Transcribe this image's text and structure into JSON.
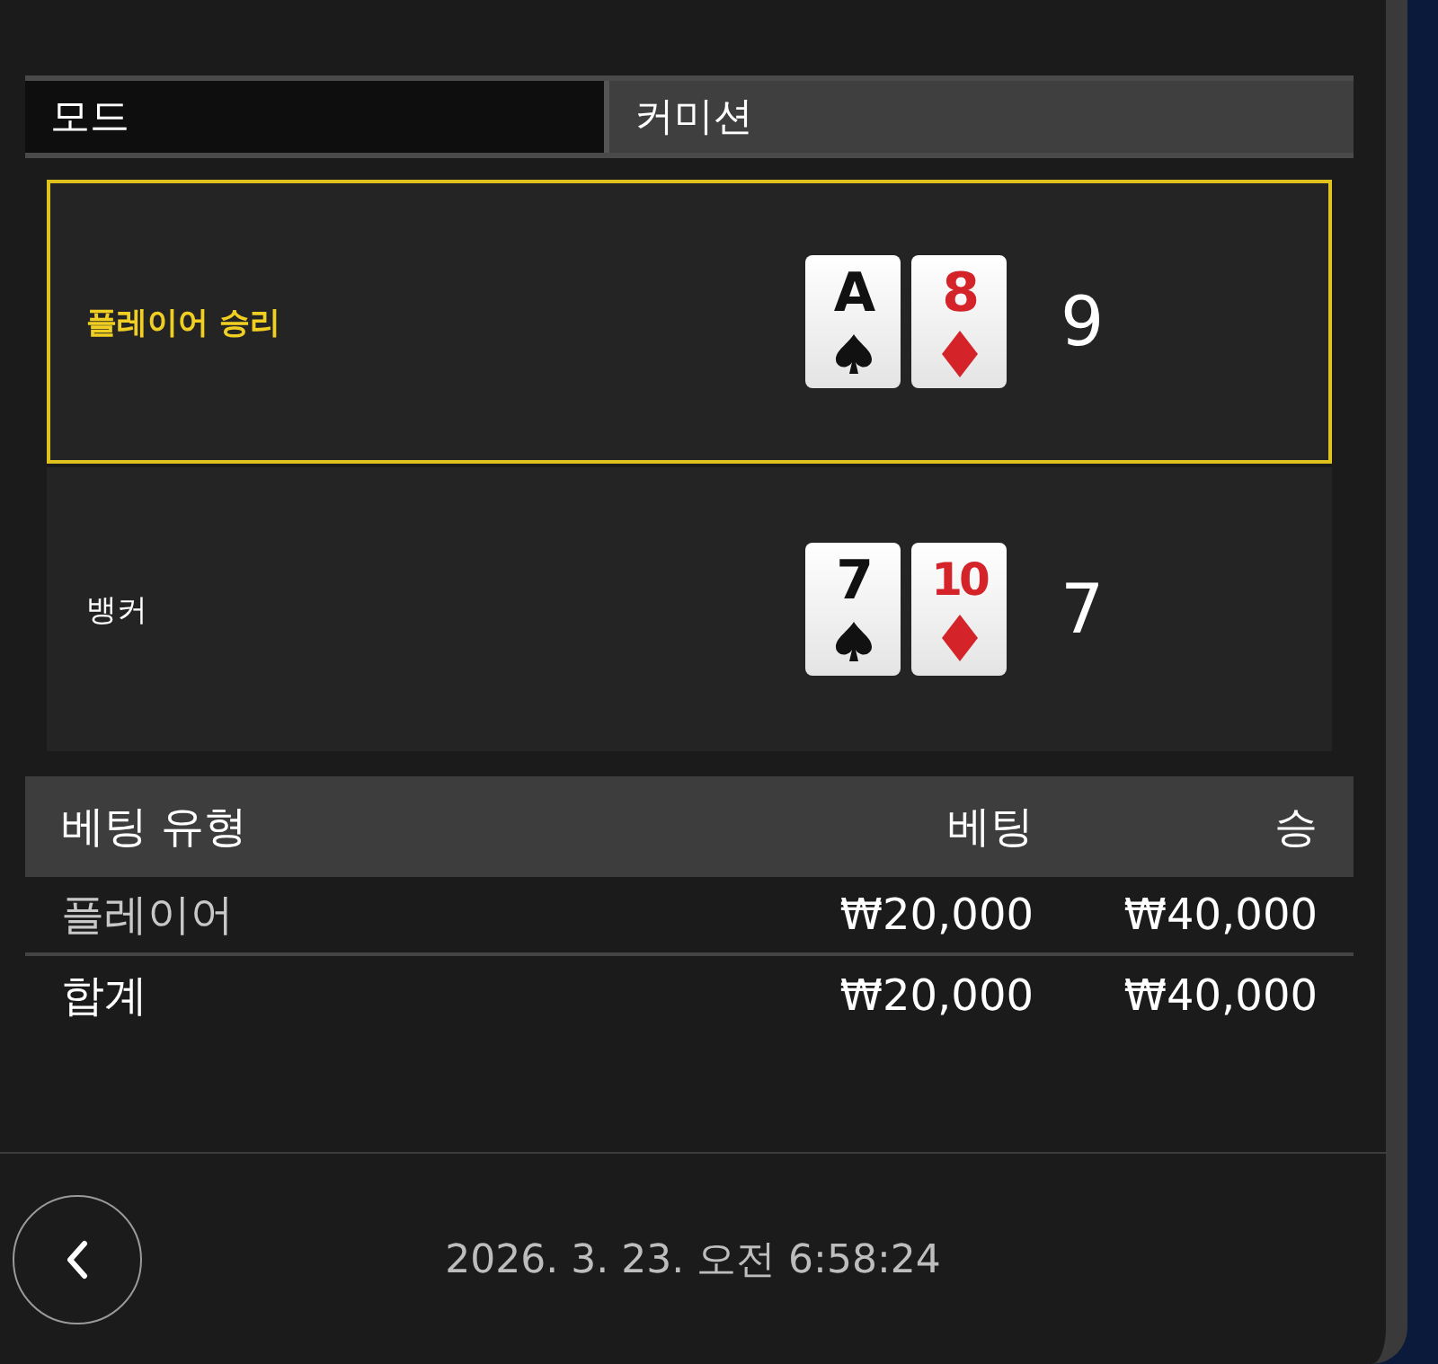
{
  "mode": {
    "label": "모드",
    "value": "커미션"
  },
  "hands": [
    {
      "label": "플레이어 승리",
      "winner": true,
      "cards": [
        {
          "rank": "A",
          "kind": "spade"
        },
        {
          "rank": "8",
          "kind": "diamond"
        }
      ],
      "total": "9"
    },
    {
      "label": "뱅커",
      "winner": false,
      "cards": [
        {
          "rank": "7",
          "kind": "spade"
        },
        {
          "rank": "10",
          "kind": "diamond"
        }
      ],
      "total": "7"
    }
  ],
  "bets": {
    "columns": [
      "베팅 유형",
      "베팅",
      "승"
    ],
    "rows": [
      {
        "cells": [
          "플레이어",
          "₩20,000",
          "₩40,000"
        ],
        "kind": "item"
      },
      {
        "cells": [
          "합계",
          "₩20,000",
          "₩40,000"
        ],
        "kind": "total"
      }
    ]
  },
  "footer": {
    "timestamp": "2026. 3. 23. 오전 6:58:24"
  }
}
